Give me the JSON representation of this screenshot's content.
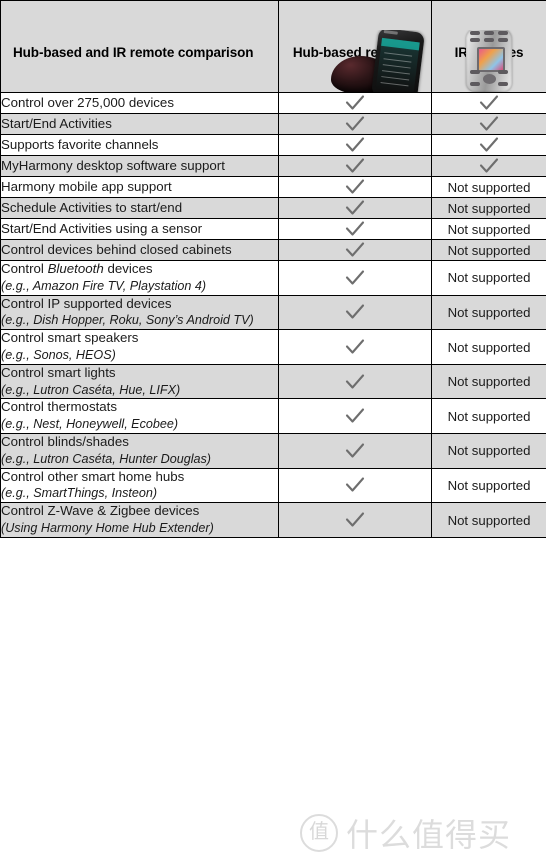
{
  "table": {
    "columns": [
      {
        "id": "feature",
        "label": "Hub-based and IR remote comparison",
        "image": ""
      },
      {
        "id": "hub",
        "label": "Hub-based remotes",
        "image": "hub-remote-photo"
      },
      {
        "id": "ir",
        "label": "IR remotes",
        "image": "ir-remote-photo"
      }
    ],
    "supported_label": "Supported",
    "not_supported_label": "Not supported",
    "check_icon": "check-icon",
    "rows": [
      {
        "feature": "Control over 275,000 devices",
        "sub": "",
        "hub": "check",
        "ir": "check"
      },
      {
        "feature": "Start/End Activities",
        "sub": "",
        "hub": "check",
        "ir": "check"
      },
      {
        "feature": "Supports favorite channels",
        "sub": "",
        "hub": "check",
        "ir": "check"
      },
      {
        "feature": "MyHarmony desktop software support",
        "sub": "",
        "hub": "check",
        "ir": "check"
      },
      {
        "feature": "Harmony mobile app support",
        "sub": "",
        "hub": "check",
        "ir": "Not supported"
      },
      {
        "feature": "Schedule Activities to start/end",
        "sub": "",
        "hub": "check",
        "ir": "Not supported"
      },
      {
        "feature": "Start/End Activities using a sensor",
        "sub": "",
        "hub": "check",
        "ir": "Not supported"
      },
      {
        "feature": "Control devices behind closed cabinets",
        "sub": "",
        "hub": "check",
        "ir": "Not supported"
      },
      {
        "feature_pre": "Control ",
        "feature_em": "Bluetooth",
        "feature_post": " devices",
        "feature": "Control Bluetooth devices",
        "sub": "(e.g., Amazon Fire TV, Playstation 4)",
        "hub": "check",
        "ir": "Not supported"
      },
      {
        "feature": "Control IP supported devices",
        "sub": "(e.g., Dish Hopper, Roku, Sony’s Android TV)",
        "hub": "check",
        "ir": "Not supported"
      },
      {
        "feature": "Control smart speakers",
        "sub": "(e.g., Sonos, HEOS)",
        "hub": "check",
        "ir": "Not supported"
      },
      {
        "feature": "Control smart lights",
        "sub": "(e.g., Lutron Caséta, Hue, LIFX)",
        "hub": "check",
        "ir": "Not supported"
      },
      {
        "feature": "Control thermostats",
        "sub": "(e.g., Nest, Honeywell, Ecobee)",
        "hub": "check",
        "ir": "Not supported"
      },
      {
        "feature": "Control blinds/shades",
        "sub": "(e.g., Lutron Caséta, Hunter Douglas)",
        "hub": "check",
        "ir": "Not supported"
      },
      {
        "feature": "Control other smart home hubs",
        "sub": "(e.g., SmartThings, Insteon)",
        "hub": "check",
        "ir": "Not supported"
      },
      {
        "feature": "Control Z-Wave & Zigbee devices",
        "sub": "(Using Harmony Home Hub Extender)",
        "hub": "check",
        "ir": "Not supported"
      }
    ]
  },
  "watermark": {
    "badge": "值",
    "text": "什么值得买"
  },
  "colors": {
    "row_alt_bg": "#d9d9d9",
    "row_bg": "#ffffff",
    "border": "#000000",
    "check": "#6e6e6e",
    "text": "#1b1b1b"
  }
}
